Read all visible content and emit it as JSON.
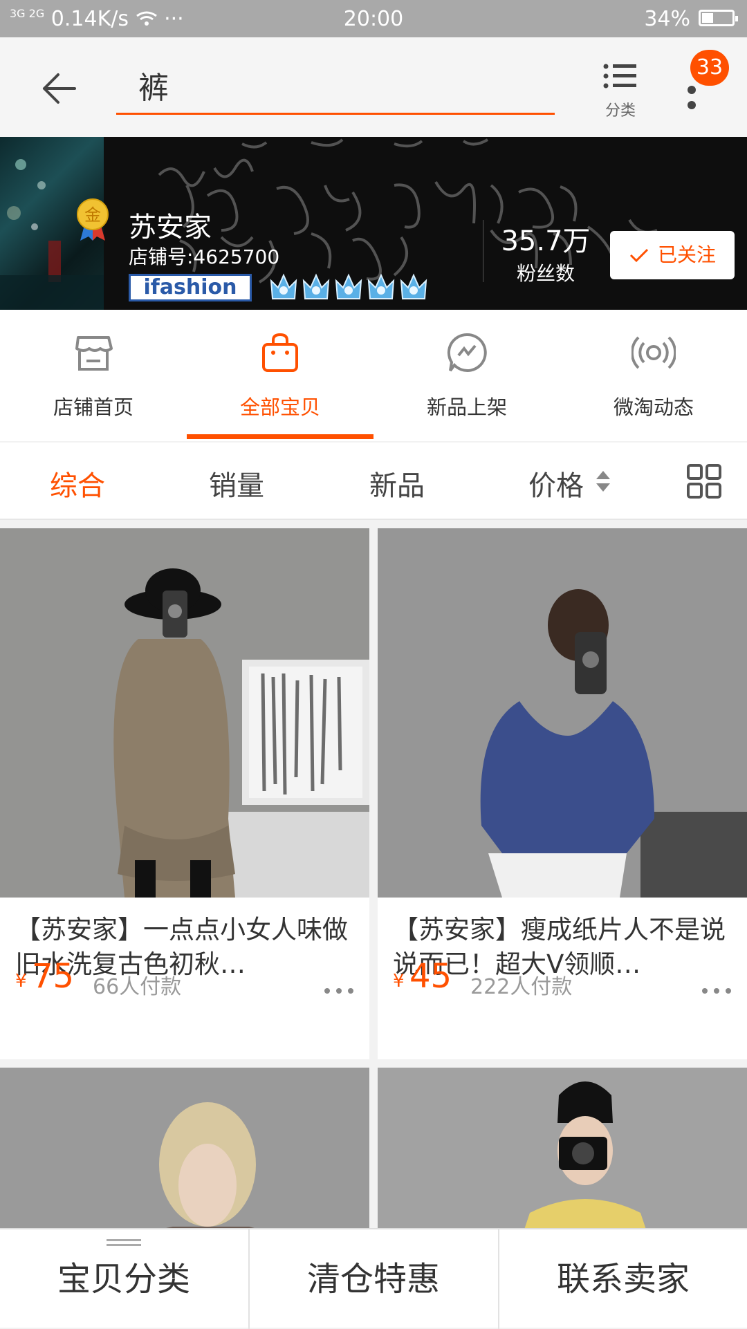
{
  "status_bar": {
    "signal_left": "3G 2G",
    "speed": "0.14K/s",
    "dots": "···",
    "time": "20:00",
    "battery": "34%"
  },
  "header": {
    "search_value": "裤",
    "category_label": "分类",
    "badge_count": "33"
  },
  "shop": {
    "name": "苏安家",
    "id_text": "店铺号:4625700",
    "ifashion": "ifashion",
    "medal_text": "金",
    "fans_count": "35.7万",
    "fans_label": "粉丝数",
    "follow_label": "已关注",
    "crown_count": 5
  },
  "tabs": [
    {
      "label": "店铺首页",
      "icon": "store-icon"
    },
    {
      "label": "全部宝贝",
      "icon": "bag-icon"
    },
    {
      "label": "新品上架",
      "icon": "lightning-bubble-icon"
    },
    {
      "label": "微淘动态",
      "icon": "broadcast-icon"
    }
  ],
  "active_tab": 1,
  "sort": {
    "zonghe": "综合",
    "xiaoliang": "销量",
    "xinpin": "新品",
    "jiage": "价格"
  },
  "products": [
    {
      "title": "【苏安家】一点点小女人味做旧水洗复古色初秋…",
      "currency": "¥",
      "price": "75",
      "sales": "66人付款"
    },
    {
      "title": "【苏安家】瘦成纸片人不是说说而已！超大V领顺…",
      "currency": "¥",
      "price": "45",
      "sales": "222人付款"
    },
    {
      "title": "",
      "currency": "",
      "price": "",
      "sales": ""
    },
    {
      "title": "",
      "currency": "",
      "price": "",
      "sales": ""
    }
  ],
  "bottom_bar": {
    "category": "宝贝分类",
    "clearance": "清仓特惠",
    "contact": "联系卖家"
  },
  "colors": {
    "accent": "#ff5000",
    "banner_bg": "#0e0e0e",
    "status_bar": "#a9a9a9"
  }
}
